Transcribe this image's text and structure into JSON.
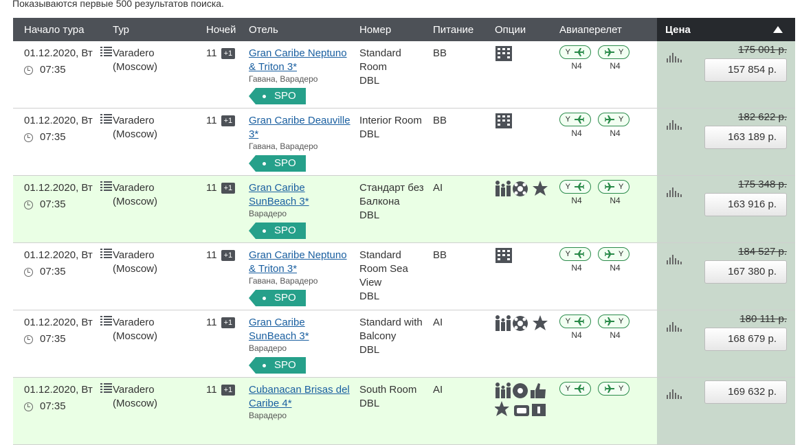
{
  "notice": "Показываются первые 500 результатов поиска.",
  "headers": {
    "start": "Начало тура",
    "tour": "Тур",
    "nights": "Ночей",
    "hotel": "Отель",
    "room": "Номер",
    "meal": "Питание",
    "options": "Опции",
    "flight": "Авиаперелет",
    "price": "Цена"
  },
  "rows": [
    {
      "date": "01.12.2020, Вт",
      "time": "07:35",
      "tour1": "Varadero",
      "tour2": "(Moscow)",
      "nights": "11",
      "plus": "+1",
      "hotel1": "Gran Caribe Neptuno",
      "hotel2": "& Triton 3*",
      "location": "Гавана, Варадеро",
      "spo": "SPO",
      "room1": "Standard",
      "room2": "Room",
      "room3": "DBL",
      "room4": "",
      "meal": "BB",
      "options": "building",
      "fclass": "Y",
      "carrier": "N4",
      "old_price": "175 001 р.",
      "price": "157 854 р.",
      "highlight": false
    },
    {
      "date": "01.12.2020, Вт",
      "time": "07:35",
      "tour1": "Varadero",
      "tour2": "(Moscow)",
      "nights": "11",
      "plus": "+1",
      "hotel1": "Gran Caribe Deauville",
      "hotel2": "3*",
      "location": "Гавана, Варадеро",
      "spo": "SPO",
      "room1": "Interior Room",
      "room2": "DBL",
      "room3": "",
      "room4": "",
      "meal": "BB",
      "options": "building",
      "fclass": "Y",
      "carrier": "N4",
      "old_price": "182 622 р.",
      "price": "163 189 р.",
      "highlight": false
    },
    {
      "date": "01.12.2020, Вт",
      "time": "07:35",
      "tour1": "Varadero",
      "tour2": "(Moscow)",
      "nights": "11",
      "plus": "+1",
      "hotel1": "Gran Caribe",
      "hotel2": "SunBeach 3*",
      "location": "Варадеро",
      "spo": "SPO",
      "room1": "Стандарт без",
      "room2": "Балкона",
      "room3": "DBL",
      "room4": "",
      "meal": "AI",
      "options": "family",
      "fclass": "Y",
      "carrier": "N4",
      "old_price": "175 348 р.",
      "price": "163 916 р.",
      "highlight": true
    },
    {
      "date": "01.12.2020, Вт",
      "time": "07:35",
      "tour1": "Varadero",
      "tour2": "(Moscow)",
      "nights": "11",
      "plus": "+1",
      "hotel1": "Gran Caribe Neptuno",
      "hotel2": "& Triton 3*",
      "location": "Гавана, Варадеро",
      "spo": "SPO",
      "room1": "Standard",
      "room2": "Room Sea",
      "room3": "View",
      "room4": "DBL",
      "meal": "BB",
      "options": "building",
      "fclass": "Y",
      "carrier": "N4",
      "old_price": "184 527 р.",
      "price": "167 380 р.",
      "highlight": false
    },
    {
      "date": "01.12.2020, Вт",
      "time": "07:35",
      "tour1": "Varadero",
      "tour2": "(Moscow)",
      "nights": "11",
      "plus": "+1",
      "hotel1": "Gran Caribe",
      "hotel2": "SunBeach 3*",
      "location": "Варадеро",
      "spo": "SPO",
      "room1": "Standard with",
      "room2": "Balcony",
      "room3": "DBL",
      "room4": "",
      "meal": "AI",
      "options": "family",
      "fclass": "Y",
      "carrier": "N4",
      "old_price": "180 111 р.",
      "price": "168 679 р.",
      "highlight": false
    },
    {
      "date": "01.12.2020, Вт",
      "time": "07:35",
      "tour1": "Varadero",
      "tour2": "(Moscow)",
      "nights": "11",
      "plus": "+1",
      "hotel1": "Cubanacan Brisas del",
      "hotel2": "Caribe 4*",
      "location": "Варадеро",
      "spo": "",
      "room1": "South Room",
      "room2": "DBL",
      "room3": "",
      "room4": "",
      "meal": "AI",
      "options": "family-plus",
      "fclass": "Y",
      "carrier": "",
      "old_price": "",
      "price": "169 632 р.",
      "highlight": true
    }
  ],
  "colors": {
    "header": "#4d5157",
    "price_header": "#26292d",
    "price_col": "#c9d9cc",
    "spo": "#26a08a",
    "highlight": "#eaffe5",
    "link": "#1a5fa0"
  }
}
